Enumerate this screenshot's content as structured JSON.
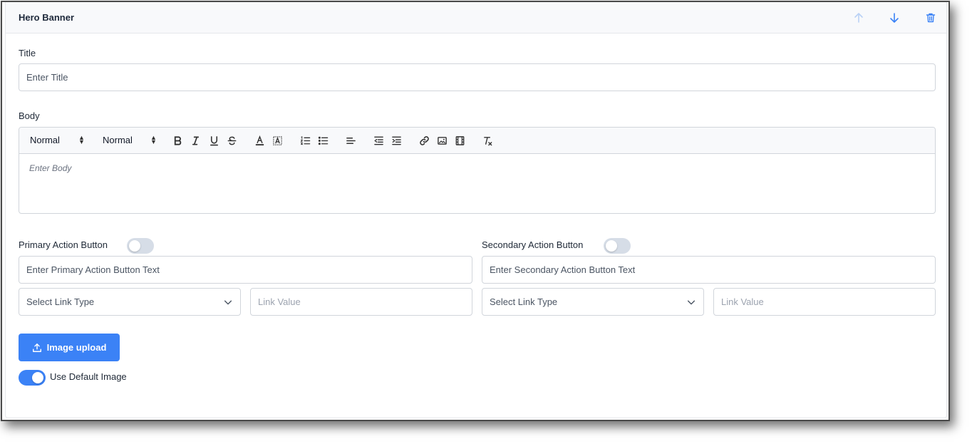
{
  "panel": {
    "title": "Hero Banner",
    "actions": {
      "move_up_icon": "arrow-up-icon",
      "move_down_icon": "arrow-down-icon",
      "delete_icon": "trash-icon"
    }
  },
  "title_field": {
    "label": "Title",
    "placeholder": "Enter Title"
  },
  "body_field": {
    "label": "Body",
    "toolbar": {
      "header_select": "Normal",
      "size_select": "Normal",
      "buttons": [
        "bold",
        "italic",
        "underline",
        "strikethrough",
        "text-color",
        "background-color",
        "ordered-list",
        "bullet-list",
        "align-left",
        "outdent",
        "indent",
        "link",
        "image",
        "video",
        "clean-format"
      ]
    },
    "placeholder": "Enter Body"
  },
  "primary_action": {
    "label": "Primary Action Button",
    "enabled": false,
    "text_placeholder": "Enter Primary Action Button Text",
    "link_type": "Select Link Type",
    "link_value_placeholder": "Link Value"
  },
  "secondary_action": {
    "label": "Secondary Action Button",
    "enabled": false,
    "text_placeholder": "Enter Secondary Action Button Text",
    "link_type": "Select Link Type",
    "link_value_placeholder": "Link Value"
  },
  "image": {
    "upload_label": "Image upload",
    "default_toggle_label": "Use Default Image",
    "use_default": true
  },
  "colors": {
    "accent": "#3b82f6",
    "toggle_off": "#d6dde7",
    "header_bg": "#f8f9fb"
  }
}
